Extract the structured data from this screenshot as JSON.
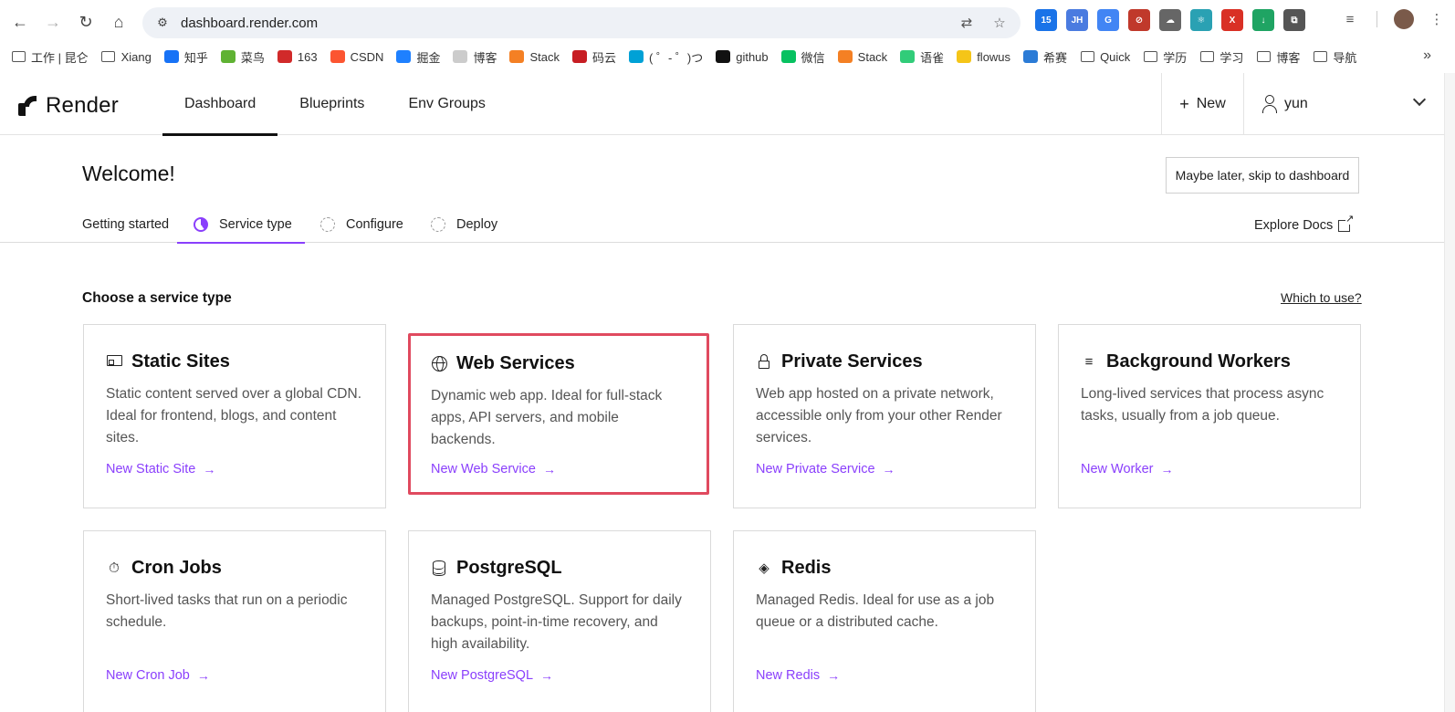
{
  "browser": {
    "url": "dashboard.render.com",
    "extensions": [
      {
        "name": "calendar-extension-icon",
        "label": "15",
        "color": "#1a73e8"
      },
      {
        "name": "jh-extension-icon",
        "label": "JH",
        "color": "#4a7be0"
      },
      {
        "name": "translate-extension-icon",
        "label": "G",
        "color": "#4285f4"
      },
      {
        "name": "block-extension-icon",
        "label": "⊘",
        "color": "#c0392b"
      },
      {
        "name": "cloud-extension-icon",
        "label": "☁",
        "color": "#666666"
      },
      {
        "name": "react-extension-icon",
        "label": "⚛",
        "color": "#2aa1b3"
      },
      {
        "name": "x-extension-icon",
        "label": "X",
        "color": "#d93025"
      },
      {
        "name": "download-extension-icon",
        "label": "↓",
        "color": "#1fa463"
      },
      {
        "name": "puzzle-extension-icon",
        "label": "⧉",
        "color": "#555555"
      }
    ],
    "bookmarks": [
      {
        "label": "工作 | 昆仑",
        "icon": "folder"
      },
      {
        "label": "Xiang",
        "icon": "folder"
      },
      {
        "label": "知乎",
        "icon": "zhihu"
      },
      {
        "label": "菜鸟",
        "icon": "runoob"
      },
      {
        "label": "163",
        "icon": "163"
      },
      {
        "label": "CSDN",
        "icon": "csdn"
      },
      {
        "label": "掘金",
        "icon": "juejin"
      },
      {
        "label": "博客",
        "icon": "blog"
      },
      {
        "label": "Stack",
        "icon": "stack"
      },
      {
        "label": "码云",
        "icon": "gitee"
      },
      {
        "label": "( ゜- ゜)つ",
        "icon": "bilibili"
      },
      {
        "label": "github",
        "icon": "github"
      },
      {
        "label": "微信",
        "icon": "wechat"
      },
      {
        "label": "Stack",
        "icon": "stack"
      },
      {
        "label": "语雀",
        "icon": "yuque"
      },
      {
        "label": "flowus",
        "icon": "flowus"
      },
      {
        "label": "希赛",
        "icon": "xisai"
      },
      {
        "label": "Quick",
        "icon": "folder"
      },
      {
        "label": "学历",
        "icon": "folder"
      },
      {
        "label": "学习",
        "icon": "folder"
      },
      {
        "label": "博客",
        "icon": "folder"
      },
      {
        "label": "导航",
        "icon": "folder"
      }
    ],
    "more_label": "»"
  },
  "header": {
    "brand": "Render",
    "tabs": [
      {
        "label": "Dashboard",
        "active": true
      },
      {
        "label": "Blueprints",
        "active": false
      },
      {
        "label": "Env Groups",
        "active": false
      }
    ],
    "new_label": "New",
    "user_name": "yun"
  },
  "onboarding": {
    "welcome": "Welcome!",
    "skip_label": "Maybe later, skip to dashboard",
    "steps": [
      {
        "label": "Getting started",
        "state": "done"
      },
      {
        "label": "Service type",
        "state": "active"
      },
      {
        "label": "Configure",
        "state": "pending"
      },
      {
        "label": "Deploy",
        "state": "pending"
      }
    ],
    "explore_docs": "Explore Docs"
  },
  "services": {
    "heading": "Choose a service type",
    "which_link": "Which to use?",
    "accent_color": "#8a3ffc",
    "highlight_color": "#e04a5f",
    "cards": [
      {
        "title": "Static Sites",
        "icon": "static-site-icon",
        "desc": "Static content served over a global CDN. Ideal for frontend, blogs, and content sites.",
        "link": "New Static Site"
      },
      {
        "title": "Web Services",
        "icon": "globe-icon",
        "desc": "Dynamic web app. Ideal for full-stack apps, API servers, and mobile backends.",
        "link": "New Web Service",
        "highlighted": true
      },
      {
        "title": "Private Services",
        "icon": "lock-icon",
        "desc": "Web app hosted on a private network, accessible only from your other Render services.",
        "link": "New Private Service"
      },
      {
        "title": "Background Workers",
        "icon": "list-play-icon",
        "desc": "Long-lived services that process async tasks, usually from a job queue.",
        "link": "New Worker"
      },
      {
        "title": "Cron Jobs",
        "icon": "stopwatch-icon",
        "desc": "Short-lived tasks that run on a periodic schedule.",
        "link": "New Cron Job"
      },
      {
        "title": "PostgreSQL",
        "icon": "database-icon",
        "desc": "Managed PostgreSQL. Support for daily backups, point-in-time recovery, and high availability.",
        "link": "New PostgreSQL"
      },
      {
        "title": "Redis",
        "icon": "layers-icon",
        "desc": "Managed Redis. Ideal for use as a job queue or a distributed cache.",
        "link": "New Redis"
      }
    ]
  }
}
